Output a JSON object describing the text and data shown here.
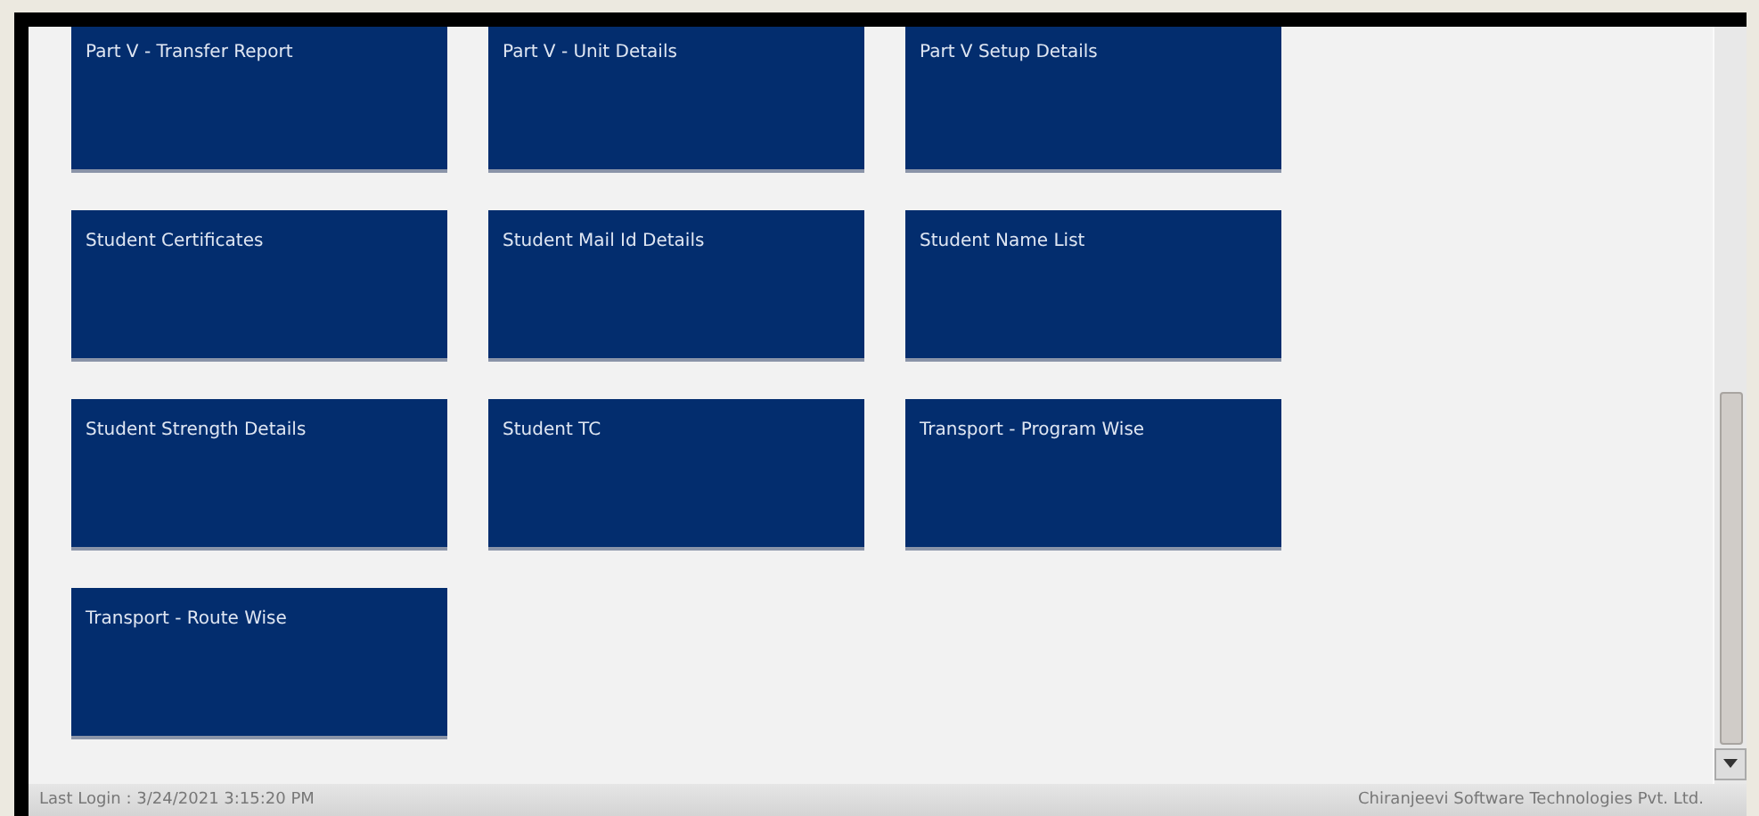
{
  "tiles": [
    {
      "label": "Part V - Transfer Report"
    },
    {
      "label": "Part V - Unit Details"
    },
    {
      "label": "Part V Setup Details"
    },
    {
      "label": "Student Certificates"
    },
    {
      "label": "Student Mail Id Details"
    },
    {
      "label": "Student Name List"
    },
    {
      "label": "Student Strength Details"
    },
    {
      "label": "Student TC"
    },
    {
      "label": "Transport - Program Wise"
    },
    {
      "label": "Transport - Route Wise"
    }
  ],
  "status_bar": {
    "left": "Last Login : 3/24/2021 3:15:20 PM",
    "right": "Chiranjeevi Software Technologies Pvt. Ltd."
  }
}
